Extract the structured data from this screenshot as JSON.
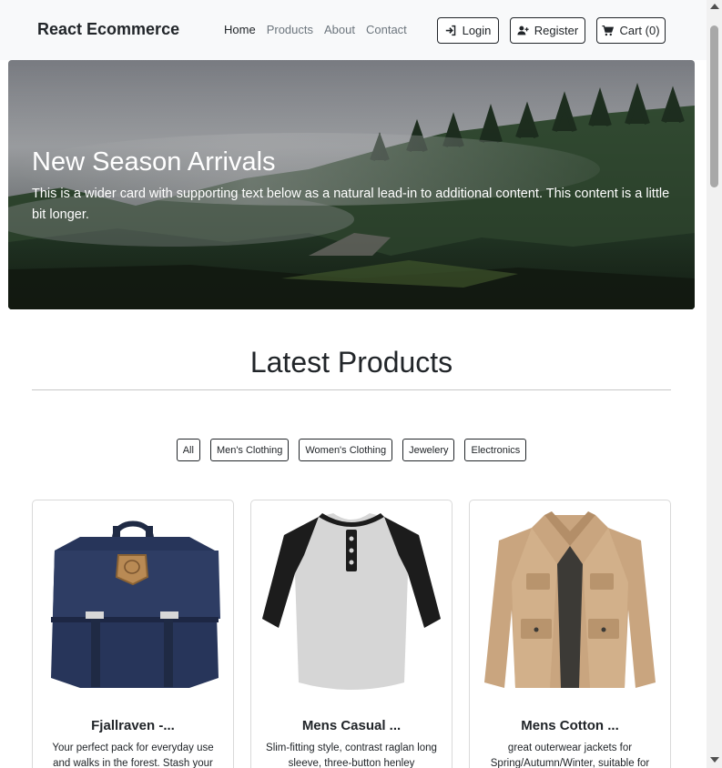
{
  "navbar": {
    "brand": "React Ecommerce",
    "links": [
      {
        "label": "Home",
        "active": true
      },
      {
        "label": "Products",
        "active": false
      },
      {
        "label": "About",
        "active": false
      },
      {
        "label": "Contact",
        "active": false
      }
    ],
    "login_label": "Login",
    "register_label": "Register",
    "cart_label": "Cart (0)"
  },
  "hero": {
    "title": "New Season Arrivals",
    "text": "This is a wider card with supporting text below as a natural lead-in to additional content. This content is a little bit longer."
  },
  "products_section": {
    "title": "Latest Products",
    "filters": [
      "All",
      "Men's Clothing",
      "Women's Clothing",
      "Jewelery",
      "Electronics"
    ]
  },
  "products": [
    {
      "title": "Fjallraven -...",
      "description": "Your perfect pack for everyday use and walks in the forest. Stash your",
      "image_icon": "backpack-icon"
    },
    {
      "title": "Mens Casual ...",
      "description": "Slim-fitting style, contrast raglan long sleeve, three-button henley",
      "image_icon": "shirt-icon"
    },
    {
      "title": "Mens Cotton ...",
      "description": "great outerwear jackets for Spring/Autumn/Winter, suitable for",
      "image_icon": "jacket-icon"
    }
  ],
  "colors": {
    "navbar_bg": "#f8f9fa",
    "text": "#212529",
    "muted": "#6c757d"
  }
}
